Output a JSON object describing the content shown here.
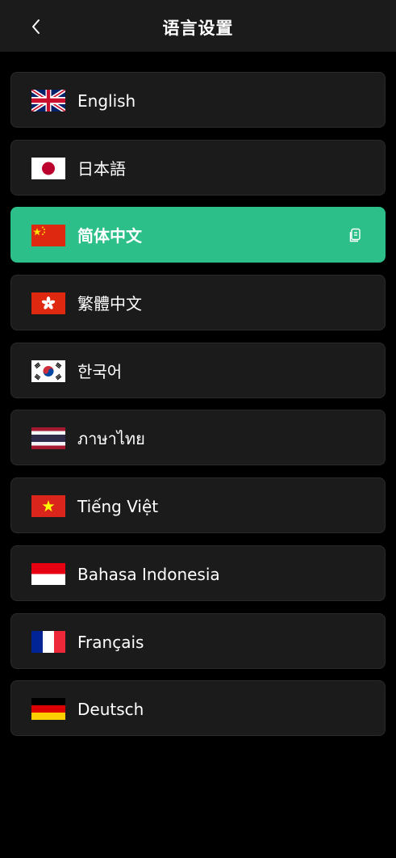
{
  "header": {
    "title": "语言设置"
  },
  "languages": [
    {
      "label": "English",
      "flag": "uk-flag-icon",
      "selected": false
    },
    {
      "label": "日本語",
      "flag": "japan-flag-icon",
      "selected": false
    },
    {
      "label": "简体中文",
      "flag": "china-flag-icon",
      "selected": true
    },
    {
      "label": "繁體中文",
      "flag": "hong-kong-flag-icon",
      "selected": false
    },
    {
      "label": "한국어",
      "flag": "south-korea-flag-icon",
      "selected": false
    },
    {
      "label": "ภาษาไทย",
      "flag": "thailand-flag-icon",
      "selected": false
    },
    {
      "label": "Tiếng Việt",
      "flag": "vietnam-flag-icon",
      "selected": false
    },
    {
      "label": "Bahasa Indonesia",
      "flag": "indonesia-flag-icon",
      "selected": false
    },
    {
      "label": "Français",
      "flag": "france-flag-icon",
      "selected": false
    },
    {
      "label": "Deutsch",
      "flag": "germany-flag-icon",
      "selected": false
    }
  ],
  "colors": {
    "background": "#000000",
    "card": "#1b1b1b",
    "selected": "#2dbf8a",
    "text": "#ffffff"
  }
}
